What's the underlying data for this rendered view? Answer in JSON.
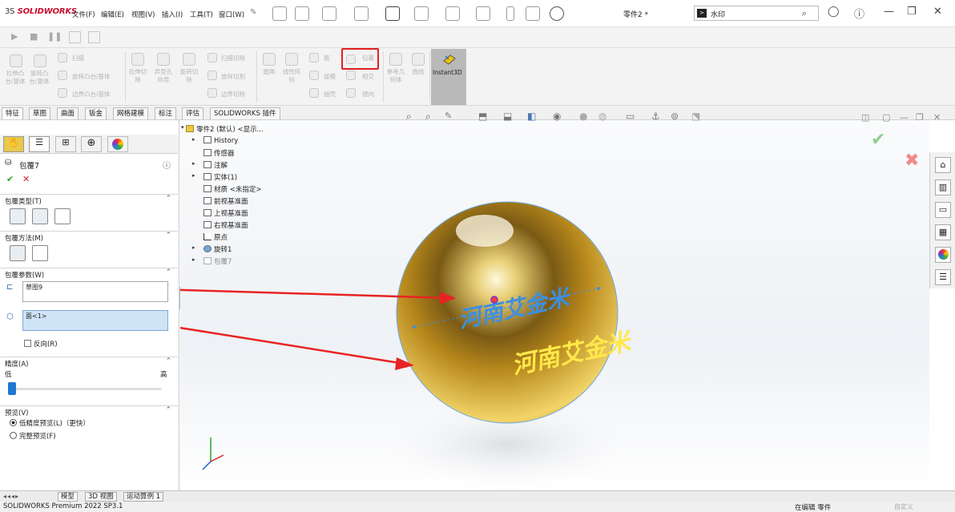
{
  "app": {
    "logo_text": "SOLIDWORKS",
    "document_title": "零件2 *"
  },
  "menu": [
    "文件(F)",
    "编辑(E)",
    "视图(V)",
    "插入(I)",
    "工具(T)",
    "窗口(W)"
  ],
  "search": {
    "value": "水印"
  },
  "ribbon": {
    "groups": [
      {
        "labels": [
          "拉伸凸台/基体",
          "旋转凸台/基体"
        ]
      },
      {
        "labels": [
          "扫描",
          "放样凸台/基体",
          "边界凸台/基体"
        ]
      },
      {
        "labels": [
          "拉伸切除",
          "异型孔向导",
          "旋转切除"
        ]
      },
      {
        "labels": [
          "扫描切除",
          "放样切割",
          "边界切除"
        ]
      },
      {
        "labels": [
          "圆角",
          "线性阵列",
          "筋",
          "拔模",
          "抽壳"
        ]
      },
      {
        "labels": [
          "包覆",
          "相交",
          "镜向"
        ]
      },
      {
        "labels": [
          "参考几何体",
          "曲线"
        ]
      }
    ],
    "instant3d_label": "Instant3D"
  },
  "command_tabs": [
    "特征",
    "草图",
    "曲面",
    "钣金",
    "焊件",
    "网格建模",
    "标注",
    "评估",
    "SOLIDWORKS 插件"
  ],
  "property_manager": {
    "title": "包覆7",
    "sections": {
      "wrap_type": "包覆类型(T)",
      "wrap_method": "包覆方法(M)",
      "wrap_params": "包覆参数(W)",
      "accuracy": "精度(A)",
      "preview": "预览(V)"
    },
    "sketch_field": "草图9",
    "face_field": "面<1>",
    "reverse_label": "反向(R)",
    "accuracy_low": "低",
    "accuracy_high": "高",
    "accuracy_level": 0.0,
    "preview_options": [
      "低精度预览(L)（更快）",
      "完整预览(F)"
    ],
    "preview_selected": 0
  },
  "feature_tree": {
    "root": "零件2 (默认) <显示...",
    "items": [
      "History",
      "传感器",
      "注解",
      "实体(1)",
      "材质 <未指定>",
      "前视基准面",
      "上视基准面",
      "右视基准面",
      "原点",
      "旋转1",
      "包覆7"
    ]
  },
  "viewport": {
    "text_on_sphere": "河南艾金米",
    "embossed_text": "河南艾金米",
    "accent_colors": {
      "gold": "#d4a418",
      "blue_text": "#3d8fe0",
      "yellow_text": "#ffe84a",
      "arrow": "#e82323",
      "highlight": "#e02020"
    }
  },
  "bottom_tabs": [
    "模型",
    "3D 视图",
    "运动算例 1"
  ],
  "status": {
    "left": "SOLIDWORKS Premium 2022 SP3.1",
    "right": "在编辑 零件",
    "custom": "自定义"
  }
}
